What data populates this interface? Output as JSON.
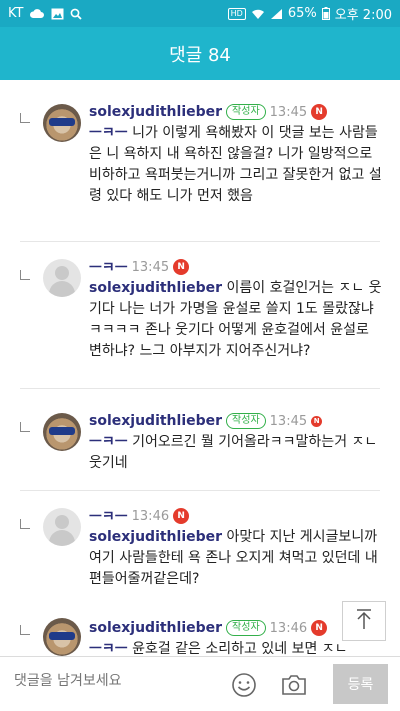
{
  "status_bar": {
    "carrier": "KT",
    "battery": "65%",
    "time": "오후 2:00",
    "hd_label": "HD",
    "icons": [
      "cloud-icon",
      "image-icon",
      "search-icon",
      "wifi-icon",
      "signal-icon",
      "battery-icon"
    ]
  },
  "header": {
    "title": "댓글 84"
  },
  "comments": [
    {
      "name": "solexjudithlieber",
      "badge": "작성자",
      "time": "13:45",
      "new": "N",
      "mention": "ㅡㅋㅡ",
      "text": " 니가 이렇게 욕해봤자 이 댓글 보는 사람들은 니 욕하지 내 욕하진 않을걸? 니가 일방적으로 비하하고 욕퍼붓는거니까 그리고 잘못한거 없고 설령 있다 해도 니가 먼저 했음"
    },
    {
      "name": "ㅡㅋㅡ",
      "time": "13:45",
      "new": "N",
      "mention": "solexjudithlieber",
      "text": " 이름이 호걸인거는 ㅈㄴ 웃기다 나는 너가 가명을 윤설로 쓸지 1도 몰랐잖냐 ㅋㅋㅋㅋ 존나 웃기다 어떻게 윤호걸에서 윤설로 변하냐? 느그 아부지가 지어주신거냐?"
    },
    {
      "name": "solexjudithlieber",
      "badge": "작성자",
      "time": "13:45",
      "new": "N",
      "mention": "ㅡㅋㅡ",
      "text": " 기어오르긴 뭘 기어올라ㅋㅋ말하는거 ㅈㄴ웃기네"
    },
    {
      "name": "ㅡㅋㅡ",
      "time": "13:46",
      "new": "N",
      "mention": "solexjudithlieber",
      "text": " 아맞다 지난 게시글보니까 여기 사람들한테 욕 존나 오지게 쳐먹고 있던데 내편들어줄꺼같은데?"
    },
    {
      "name": "solexjudithlieber",
      "badge": "작성자",
      "time": "13:46",
      "new": "N",
      "mention": "ㅡㅋㅡ",
      "text": " 윤호걸 같은 소리하고 있네 보면 ㅈㄴ"
    }
  ],
  "input": {
    "placeholder": "댓글을 남겨보세요"
  },
  "submit_label": "등록"
}
